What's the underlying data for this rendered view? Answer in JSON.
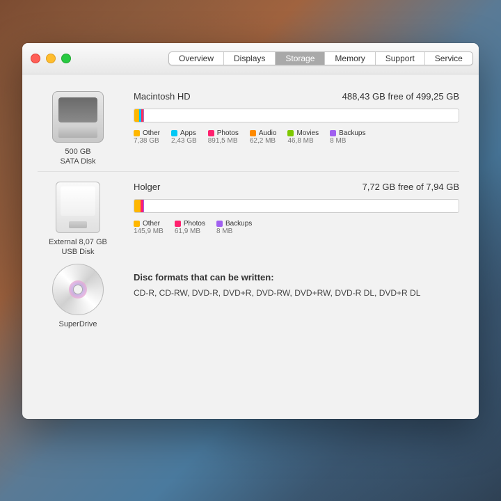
{
  "tabs": [
    "Overview",
    "Displays",
    "Storage",
    "Memory",
    "Support",
    "Service"
  ],
  "activeTab": 2,
  "drives": [
    {
      "icon": "hdd",
      "caption": "500 GB\nSATA Disk",
      "name": "Macintosh HD",
      "freeText": "488,43 GB free of 499,25 GB",
      "segments": [
        {
          "color": "c-other",
          "pct": 1.6
        },
        {
          "color": "c-apps",
          "pct": 0.6
        },
        {
          "color": "c-photos",
          "pct": 0.3
        },
        {
          "color": "c-audio",
          "pct": 0.2
        },
        {
          "color": "c-movies",
          "pct": 0.2
        },
        {
          "color": "c-backup",
          "pct": 0.2
        }
      ],
      "legend": [
        {
          "color": "c-other",
          "name": "Other",
          "val": "7,38 GB"
        },
        {
          "color": "c-apps",
          "name": "Apps",
          "val": "2,43 GB"
        },
        {
          "color": "c-photos",
          "name": "Photos",
          "val": "891,5 MB"
        },
        {
          "color": "c-audio",
          "name": "Audio",
          "val": "62,2 MB"
        },
        {
          "color": "c-movies",
          "name": "Movies",
          "val": "46,8 MB"
        },
        {
          "color": "c-backup",
          "name": "Backups",
          "val": "8 MB"
        }
      ]
    },
    {
      "icon": "ext",
      "caption": "External 8,07 GB\nUSB Disk",
      "name": "Holger",
      "freeText": "7,72 GB free of 7,94 GB",
      "segments": [
        {
          "color": "c-other",
          "pct": 1.9
        },
        {
          "color": "c-photos",
          "pct": 0.9
        },
        {
          "color": "c-backup",
          "pct": 0.3
        }
      ],
      "legend": [
        {
          "color": "c-other",
          "name": "Other",
          "val": "145,9 MB"
        },
        {
          "color": "c-photos",
          "name": "Photos",
          "val": "61,9 MB"
        },
        {
          "color": "c-backup",
          "name": "Backups",
          "val": "8 MB"
        }
      ]
    }
  ],
  "superdrive": {
    "caption": "SuperDrive",
    "header": "Disc formats that can be written:",
    "formats": "CD-R, CD-RW, DVD-R, DVD+R, DVD-RW, DVD+RW, DVD-R DL, DVD+R DL"
  }
}
